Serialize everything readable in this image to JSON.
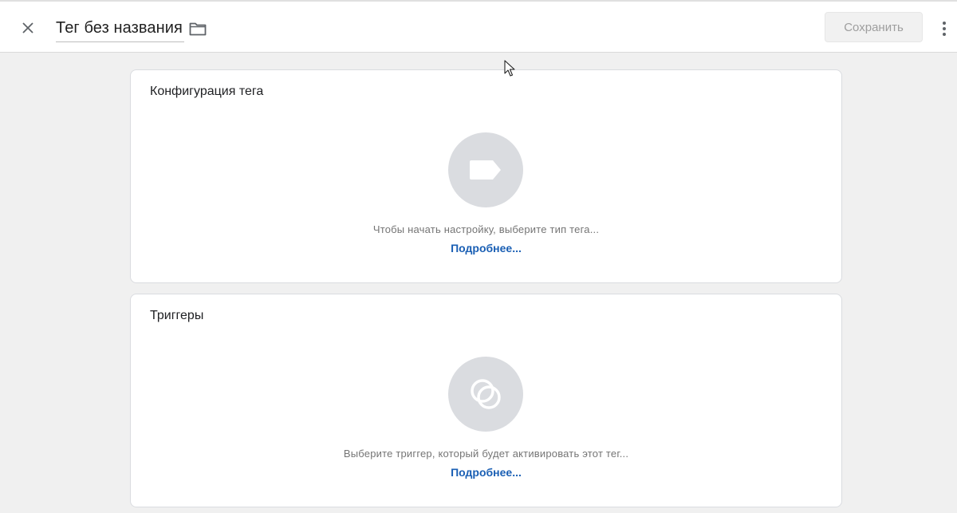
{
  "header": {
    "title": "Тег без названия",
    "save_label": "Сохранить",
    "close_icon": "close-icon",
    "folder_icon": "folder-icon",
    "more_icon": "more-vert-icon"
  },
  "tag_config": {
    "title": "Конфигурация тега",
    "icon": "tag-icon",
    "hint": "Чтобы начать настройку, выберите тип тега...",
    "more_link": "Подробнее..."
  },
  "triggers": {
    "title": "Триггеры",
    "icon": "trigger-icon",
    "hint": "Выберите триггер, который будет активировать этот тег...",
    "more_link": "Подробнее..."
  },
  "colors": {
    "link": "#1a5fb4",
    "icon_circle": "#dadce0",
    "background": "#f0f0f0"
  }
}
